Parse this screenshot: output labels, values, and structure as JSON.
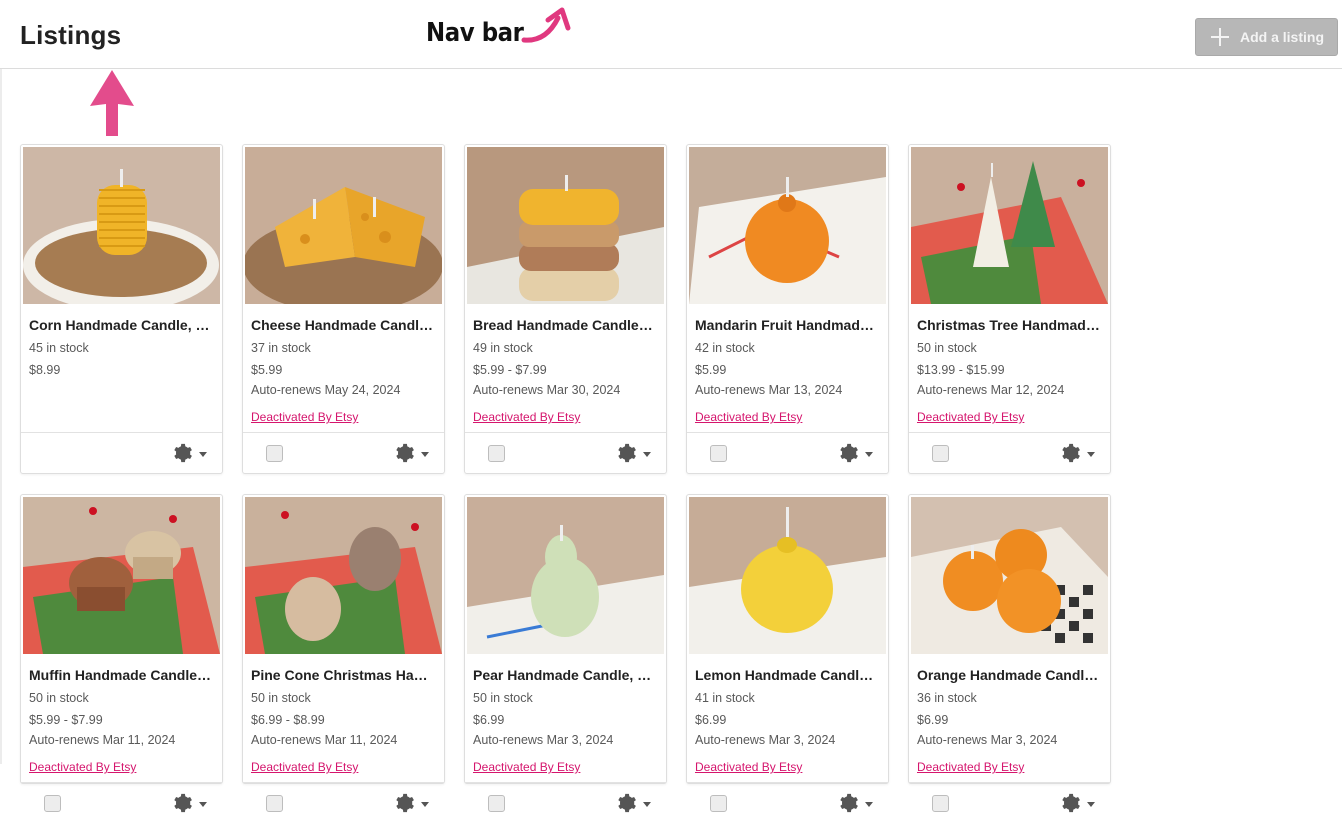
{
  "header": {
    "title": "Listings",
    "annotation": "Nav bar",
    "add_label": "Add a listing"
  },
  "colors": {
    "accent_pink": "#d5156d",
    "button_disabled": "#b7b7b7",
    "annotation_pink": "#e0387f"
  },
  "icons": {
    "add": "plus-icon",
    "settings": "gear-icon",
    "dropdown": "caret-down-icon",
    "annotation_up": "arrow-up-icon",
    "annotation_nav": "curved-arrow-icon"
  },
  "listings": [
    {
      "title": "Corn Handmade Candle, …",
      "stock": "45 in stock",
      "price": "$8.99",
      "renews": "",
      "status": "",
      "checkbox": false
    },
    {
      "title": "Cheese Handmade Candl…",
      "stock": "37 in stock",
      "price": "$5.99",
      "renews": "Auto-renews May 24, 2024",
      "status": "Deactivated By Etsy",
      "checkbox": true
    },
    {
      "title": "Bread Handmade Candle, …",
      "stock": "49 in stock",
      "price": "$5.99 - $7.99",
      "renews": "Auto-renews Mar 30, 2024",
      "status": "Deactivated By Etsy",
      "checkbox": true
    },
    {
      "title": "Mandarin Fruit Handmade…",
      "stock": "42 in stock",
      "price": "$5.99",
      "renews": "Auto-renews Mar 13, 2024",
      "status": "Deactivated By Etsy",
      "checkbox": true
    },
    {
      "title": "Christmas Tree Handmad…",
      "stock": "50 in stock",
      "price": "$13.99 - $15.99",
      "renews": "Auto-renews Mar 12, 2024",
      "status": "Deactivated By Etsy",
      "checkbox": true
    },
    {
      "title": "Muffin Handmade Candle,…",
      "stock": "50 in stock",
      "price": "$5.99 - $7.99",
      "renews": "Auto-renews Mar 11, 2024",
      "status": "Deactivated By Etsy",
      "checkbox": true
    },
    {
      "title": "Pine Cone Christmas Han…",
      "stock": "50 in stock",
      "price": "$6.99 - $8.99",
      "renews": "Auto-renews Mar 11, 2024",
      "status": "Deactivated By Etsy",
      "checkbox": true
    },
    {
      "title": "Pear Handmade Candle, F…",
      "stock": "50 in stock",
      "price": "$6.99",
      "renews": "Auto-renews Mar 3, 2024",
      "status": "Deactivated By Etsy",
      "checkbox": true
    },
    {
      "title": "Lemon Handmade Candle…",
      "stock": "41 in stock",
      "price": "$6.99",
      "renews": "Auto-renews Mar 3, 2024",
      "status": "Deactivated By Etsy",
      "checkbox": true
    },
    {
      "title": "Orange Handmade Candl…",
      "stock": "36 in stock",
      "price": "$6.99",
      "renews": "Auto-renews Mar 3, 2024",
      "status": "Deactivated By Etsy",
      "checkbox": true
    }
  ]
}
